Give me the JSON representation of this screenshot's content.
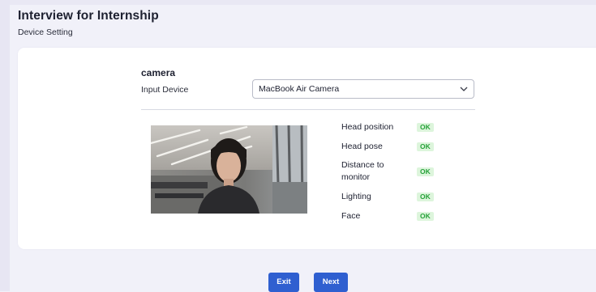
{
  "header": {
    "title": "Interview for Internship",
    "subtitle": "Device Setting"
  },
  "camera": {
    "heading": "camera",
    "input_label": "Input Device",
    "select": {
      "value": "MacBook Air Camera"
    }
  },
  "checks": [
    {
      "label": "Head position",
      "status": "OK"
    },
    {
      "label": "Head pose",
      "status": "OK"
    },
    {
      "label": "Distance to",
      "label_line2": "monitor",
      "status": "OK"
    },
    {
      "label": "Lighting",
      "status": "OK"
    },
    {
      "label": "Face",
      "status": "OK"
    }
  ],
  "buttons": {
    "exit": "Exit",
    "next": "Next"
  },
  "colors": {
    "primary": "#2f5fd0",
    "ok_bg": "#ddf5dc",
    "ok_text": "#27a23a"
  }
}
